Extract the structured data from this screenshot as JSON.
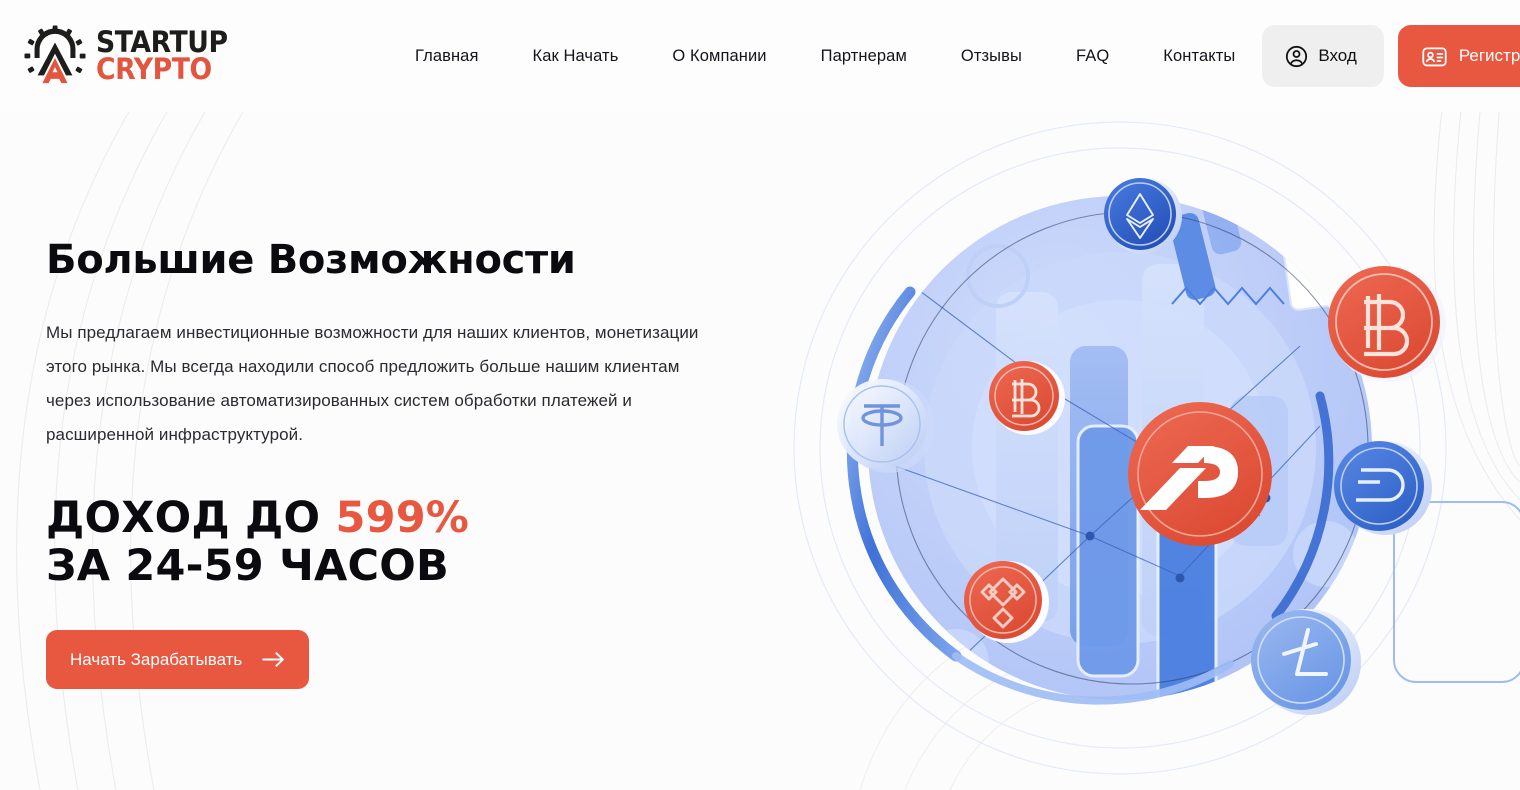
{
  "brand": {
    "name_line1": "STARTUP",
    "name_line2": "CRYPTO",
    "accent_color": "#e8573f",
    "dark_color": "#1d1d1b",
    "logo_icon": "gear-mountain-logo-icon"
  },
  "nav": {
    "items": [
      {
        "label": "Главная"
      },
      {
        "label": "Как Начать"
      },
      {
        "label": "О Компании"
      },
      {
        "label": "Партнерам"
      },
      {
        "label": "Отзывы"
      },
      {
        "label": "FAQ"
      },
      {
        "label": "Контакты"
      }
    ]
  },
  "auth": {
    "login_label": "Вход",
    "login_icon": "user-circle-icon",
    "register_label": "Регистрация",
    "register_icon": "id-card-icon"
  },
  "hero": {
    "title": "Большие Возможности",
    "paragraph": "Мы предлагаем инвестиционные возможности для наших клиентов, монетизации этого рынка. Мы всегда находили способ предложить больше нашим клиентам через использование автоматизированных систем обработки платежей и расширенной инфраструктурой.",
    "income_prefix": "ДОХОД ДО ",
    "income_percent": "599%",
    "income_line2": "ЗА 24-59 ЧАСОВ",
    "cta_label": "Начать Зарабатывать",
    "cta_icon": "arrow-right-icon"
  },
  "illustration": {
    "name": "crypto-network-illustration",
    "center_coin": "startup-crypto-logo-coin",
    "coins": [
      {
        "name": "ethereum-coin",
        "symbol": "ETH",
        "color": "#2f63cf"
      },
      {
        "name": "bitcoin-coin-large",
        "symbol": "BTC",
        "color": "#e8573f"
      },
      {
        "name": "bitcoin-coin-small",
        "symbol": "BTC",
        "color": "#e8573f"
      },
      {
        "name": "tether-coin",
        "symbol": "USDT",
        "color": "#c9d8f5"
      },
      {
        "name": "binance-coin",
        "symbol": "BNB",
        "color": "#e2573f"
      },
      {
        "name": "dash-coin",
        "symbol": "DASH",
        "color": "#2f63cf"
      },
      {
        "name": "litecoin-coin",
        "symbol": "LTC",
        "color": "#6f9ae8"
      }
    ]
  }
}
